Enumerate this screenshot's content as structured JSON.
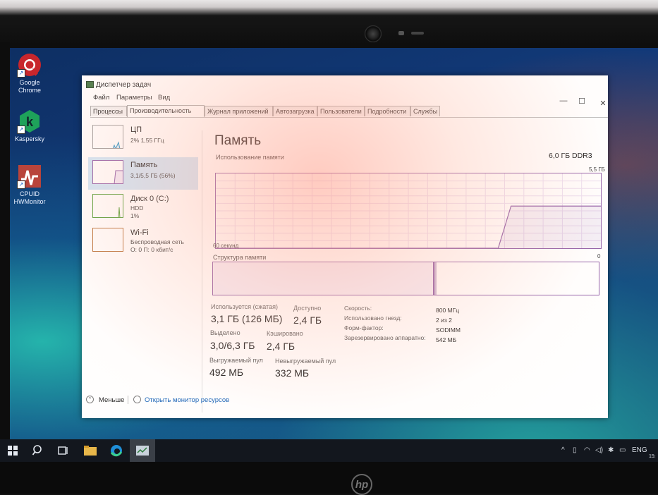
{
  "desktop": {
    "icons": [
      {
        "label": "Google Chrome"
      },
      {
        "label": "Kaspersky"
      },
      {
        "label": "CPUID HWMonitor"
      }
    ]
  },
  "window": {
    "title": "Диспетчер задач",
    "menu": [
      "Файл",
      "Параметры",
      "Вид"
    ],
    "controls": {
      "minimize": "—",
      "maximize": "☐",
      "close": "✕"
    },
    "tabs": [
      "Процессы",
      "Производительность",
      "Журнал приложений",
      "Автозагрузка",
      "Пользователи",
      "Подробности",
      "Службы"
    ],
    "active_tab": "Производительность"
  },
  "side_panel": {
    "items": [
      {
        "title": "ЦП",
        "lines": [
          "2%  1,55 ГГц"
        ],
        "color": "#1f8fc4"
      },
      {
        "title": "Память",
        "lines": [
          "3,1/5,5 ГБ (56%)"
        ],
        "color": "#8b56a3",
        "selected": true
      },
      {
        "title": "Диск 0 (C:)",
        "lines": [
          "HDD",
          "1%"
        ],
        "color": "#4d9a2c"
      },
      {
        "title": "Wi-Fi",
        "lines": [
          "Беспроводная сеть",
          "О: 0 П: 0 кбит/с"
        ],
        "color": "#b56a2e"
      }
    ]
  },
  "memory": {
    "title": "Память",
    "type": "6,0 ГБ DDR3",
    "usage_label": "Использование памяти",
    "max_label": "5,5 ГБ",
    "time_label": "60 секунд",
    "zero_label": "0",
    "composition_label": "Структура памяти",
    "composition_used_fraction": 0.57,
    "stats": {
      "in_use_label": "Используется (сжатая)",
      "in_use_value": "3,1 ГБ (126 МБ)",
      "available_label": "Доступно",
      "available_value": "2,4 ГБ",
      "committed_label": "Выделено",
      "committed_value": "3,0/6,3 ГБ",
      "cached_label": "Кэшировано",
      "cached_value": "2,4 ГБ",
      "paged_label": "Выгружаемый пул",
      "paged_value": "492 МБ",
      "nonpaged_label": "Невыгружаемый пул",
      "nonpaged_value": "332 МБ"
    },
    "info": {
      "speed_label": "Скорость:",
      "speed_value": "800 МГц",
      "slots_label": "Использовано гнезд:",
      "slots_value": "2 из 2",
      "form_label": "Форм-фактор:",
      "form_value": "SODIMM",
      "reserved_label": "Зарезервировано аппаратно:",
      "reserved_value": "542 МБ"
    },
    "chart_data": {
      "type": "area",
      "x": [
        0,
        44,
        46,
        60
      ],
      "values": [
        0,
        0,
        3.1,
        3.1
      ],
      "xlim": [
        0,
        60
      ],
      "ylim": [
        0,
        5.5
      ],
      "grid": true
    }
  },
  "footer": {
    "less_label": "Меньше",
    "monitor_link": "Открыть монитор ресурсов"
  },
  "taskbar": {
    "lang": "ENG",
    "clock": "15:"
  }
}
